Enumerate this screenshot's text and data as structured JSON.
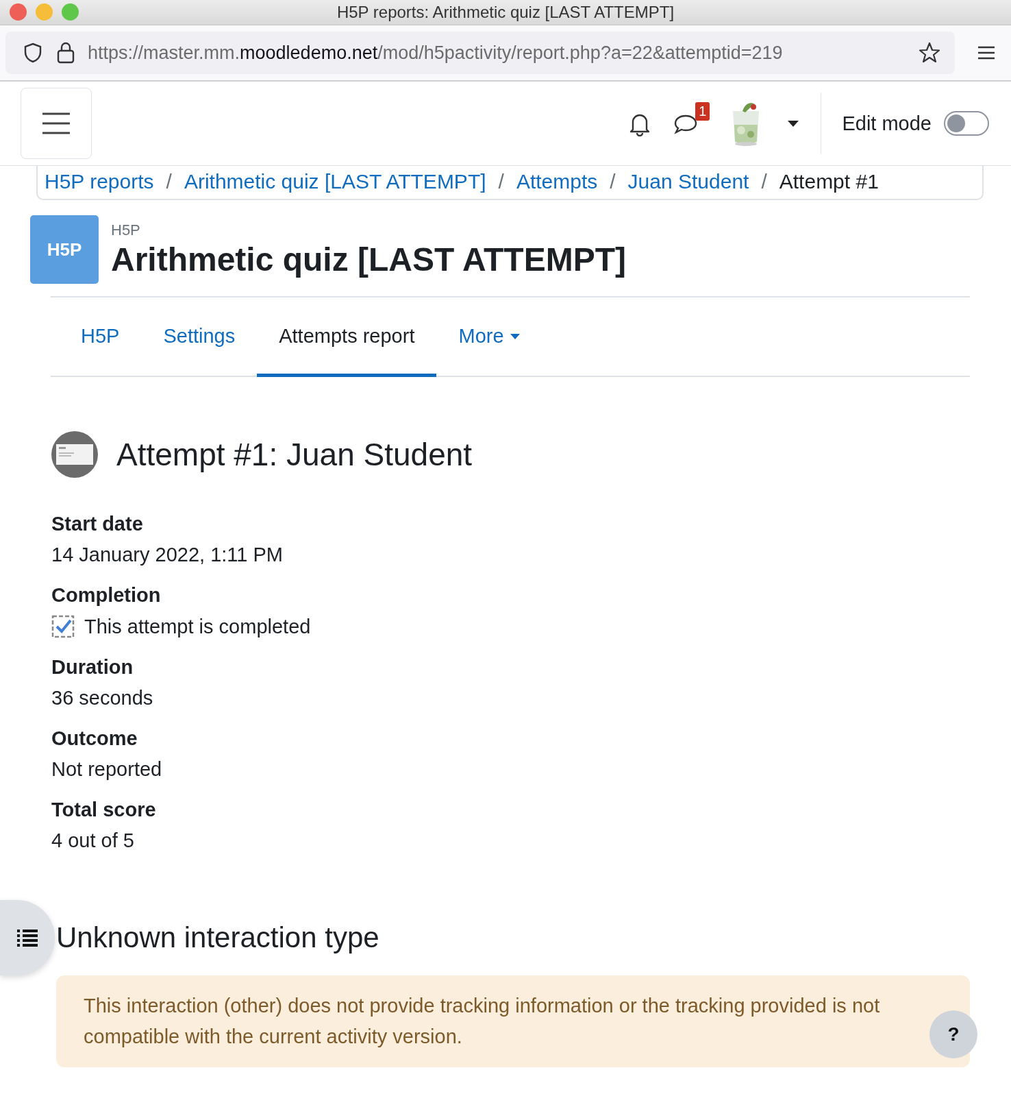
{
  "window": {
    "title": "H5P reports: Arithmetic quiz [LAST ATTEMPT]"
  },
  "address_bar": {
    "url_prefix": "https://master.mm.",
    "url_domain": "moodledemo.net",
    "url_suffix": "/mod/h5pactivity/report.php?a=22&attemptid=219"
  },
  "navbar": {
    "messages_badge": "1",
    "edit_mode_label": "Edit mode",
    "edit_mode_on": false
  },
  "breadcrumb_separator": "/",
  "breadcrumb": [
    {
      "label": "H5P reports",
      "kind": "link"
    },
    {
      "label": "Arithmetic quiz [LAST ATTEMPT]",
      "kind": "link"
    },
    {
      "label": "Attempts",
      "kind": "link"
    },
    {
      "label": "Juan Student",
      "kind": "link"
    },
    {
      "label": "Attempt #1",
      "kind": "current"
    }
  ],
  "activity": {
    "type_label": "H5P",
    "icon_text": "H5P",
    "title": "Arithmetic quiz [LAST ATTEMPT]"
  },
  "tabs": [
    {
      "label": "H5P",
      "selected": false,
      "kind": "link"
    },
    {
      "label": "Settings",
      "selected": false,
      "kind": "link"
    },
    {
      "label": "Attempts report",
      "selected": true,
      "kind": "link"
    },
    {
      "label": "More",
      "selected": false,
      "kind": "dropdown"
    }
  ],
  "attempt": {
    "heading": "Attempt #1: Juan Student"
  },
  "details": [
    {
      "label": "Start date",
      "value": "14 January 2022, 1:11 PM",
      "kind": "text"
    },
    {
      "label": "Completion",
      "value": "This attempt is completed",
      "kind": "checkbox",
      "checked": true
    },
    {
      "label": "Duration",
      "value": "36 seconds",
      "kind": "text"
    },
    {
      "label": "Outcome",
      "value": "Not reported",
      "kind": "text"
    },
    {
      "label": "Total score",
      "value": "4 out of 5",
      "kind": "text"
    }
  ],
  "interaction": {
    "heading": "Unknown interaction type",
    "message": "This interaction (other) does not provide tracking information or the tracking provided is not compatible with the current activity version.",
    "help_button": "?"
  }
}
